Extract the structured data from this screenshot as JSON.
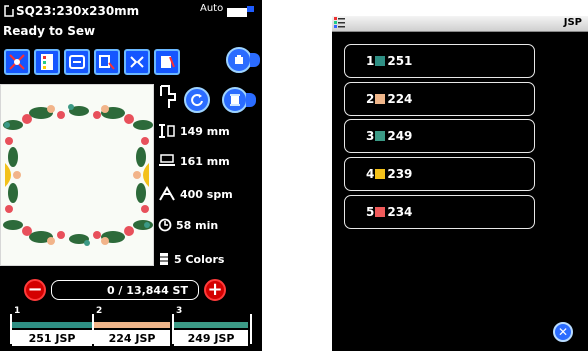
{
  "left_screen": {
    "design_name": "SQ23:230x230mm",
    "mode_label": "Auto",
    "status": "Ready to Sew",
    "specs": {
      "height": "149 mm",
      "width": "161 mm",
      "speed": "400 spm",
      "time": "58 min",
      "colors": "5 Colors"
    },
    "stitch_counter": "0 / 13,844 ST",
    "sequence": [
      {
        "num": "1",
        "label": "251 JSP",
        "color": "#2f8f84"
      },
      {
        "num": "2",
        "label": "224 JSP",
        "color": "#efb58a"
      },
      {
        "num": "3",
        "label": "249 JSP",
        "color": "#3c9a86"
      }
    ],
    "toolbar_icons": [
      "hoop-select-icon",
      "color-list-icon",
      "frame-move-icon",
      "trace-icon",
      "mirror-icon",
      "color-change-icon"
    ]
  },
  "right_screen": {
    "title": "JSP",
    "colors": [
      {
        "index": "1",
        "code": "251",
        "color": "#2f8f84"
      },
      {
        "index": "2",
        "code": "224",
        "color": "#efb58a"
      },
      {
        "index": "3",
        "code": "249",
        "color": "#3c9a86"
      },
      {
        "index": "4",
        "code": "239",
        "color": "#f3c11a"
      },
      {
        "index": "5",
        "code": "234",
        "color": "#ef5a5a"
      }
    ]
  }
}
